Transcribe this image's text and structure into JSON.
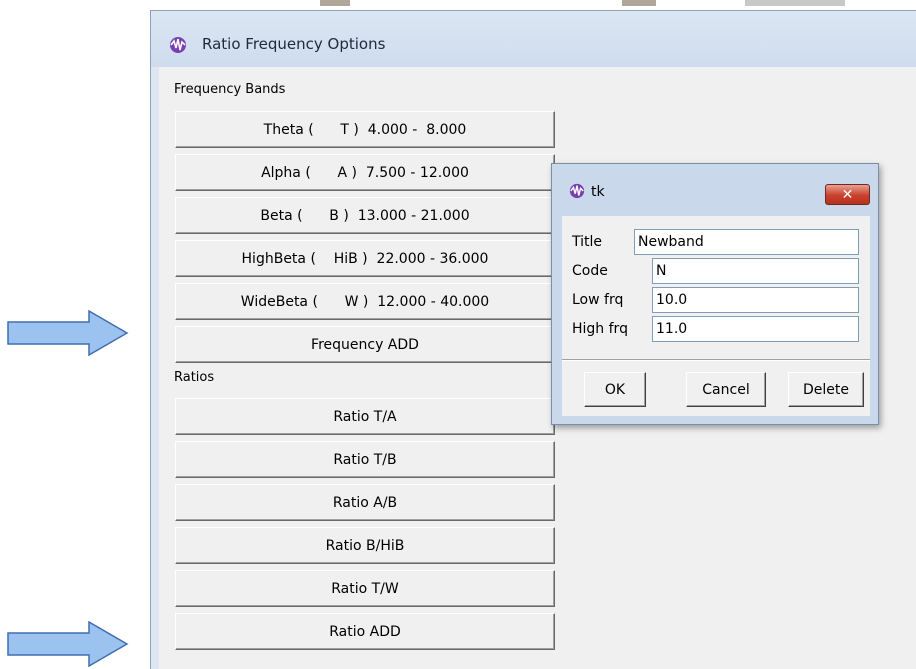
{
  "window": {
    "title": "Ratio Frequency Options"
  },
  "frequency_bands": {
    "label": "Frequency Bands",
    "items": [
      "Theta (      T )  4.000 -  8.000",
      "Alpha (      A )  7.500 - 12.000",
      "Beta (      B )  13.000 - 21.000",
      "HighBeta (    HiB )  22.000 - 36.000",
      "WideBeta (      W )  12.000 - 40.000"
    ],
    "add_label": "Frequency ADD"
  },
  "ratios": {
    "label": "Ratios",
    "items": [
      "Ratio T/A",
      "Ratio T/B",
      "Ratio A/B",
      "Ratio B/HiB",
      "Ratio T/W"
    ],
    "add_label": "Ratio ADD"
  },
  "dialog": {
    "title": "tk",
    "close_glyph": "✕",
    "fields": {
      "title_label": "Title",
      "title_value": "Newband",
      "code_label": "Code",
      "code_value": "N",
      "low_label": "Low  frq",
      "low_value": "10.0",
      "high_label": "High frq",
      "high_value": "11.0"
    },
    "buttons": {
      "ok": "OK",
      "cancel": "Cancel",
      "delete": "Delete"
    }
  },
  "colors": {
    "arrow_fill": "#9cc3f0",
    "arrow_stroke": "#3f6fb0",
    "close_red": "#c9412c"
  }
}
